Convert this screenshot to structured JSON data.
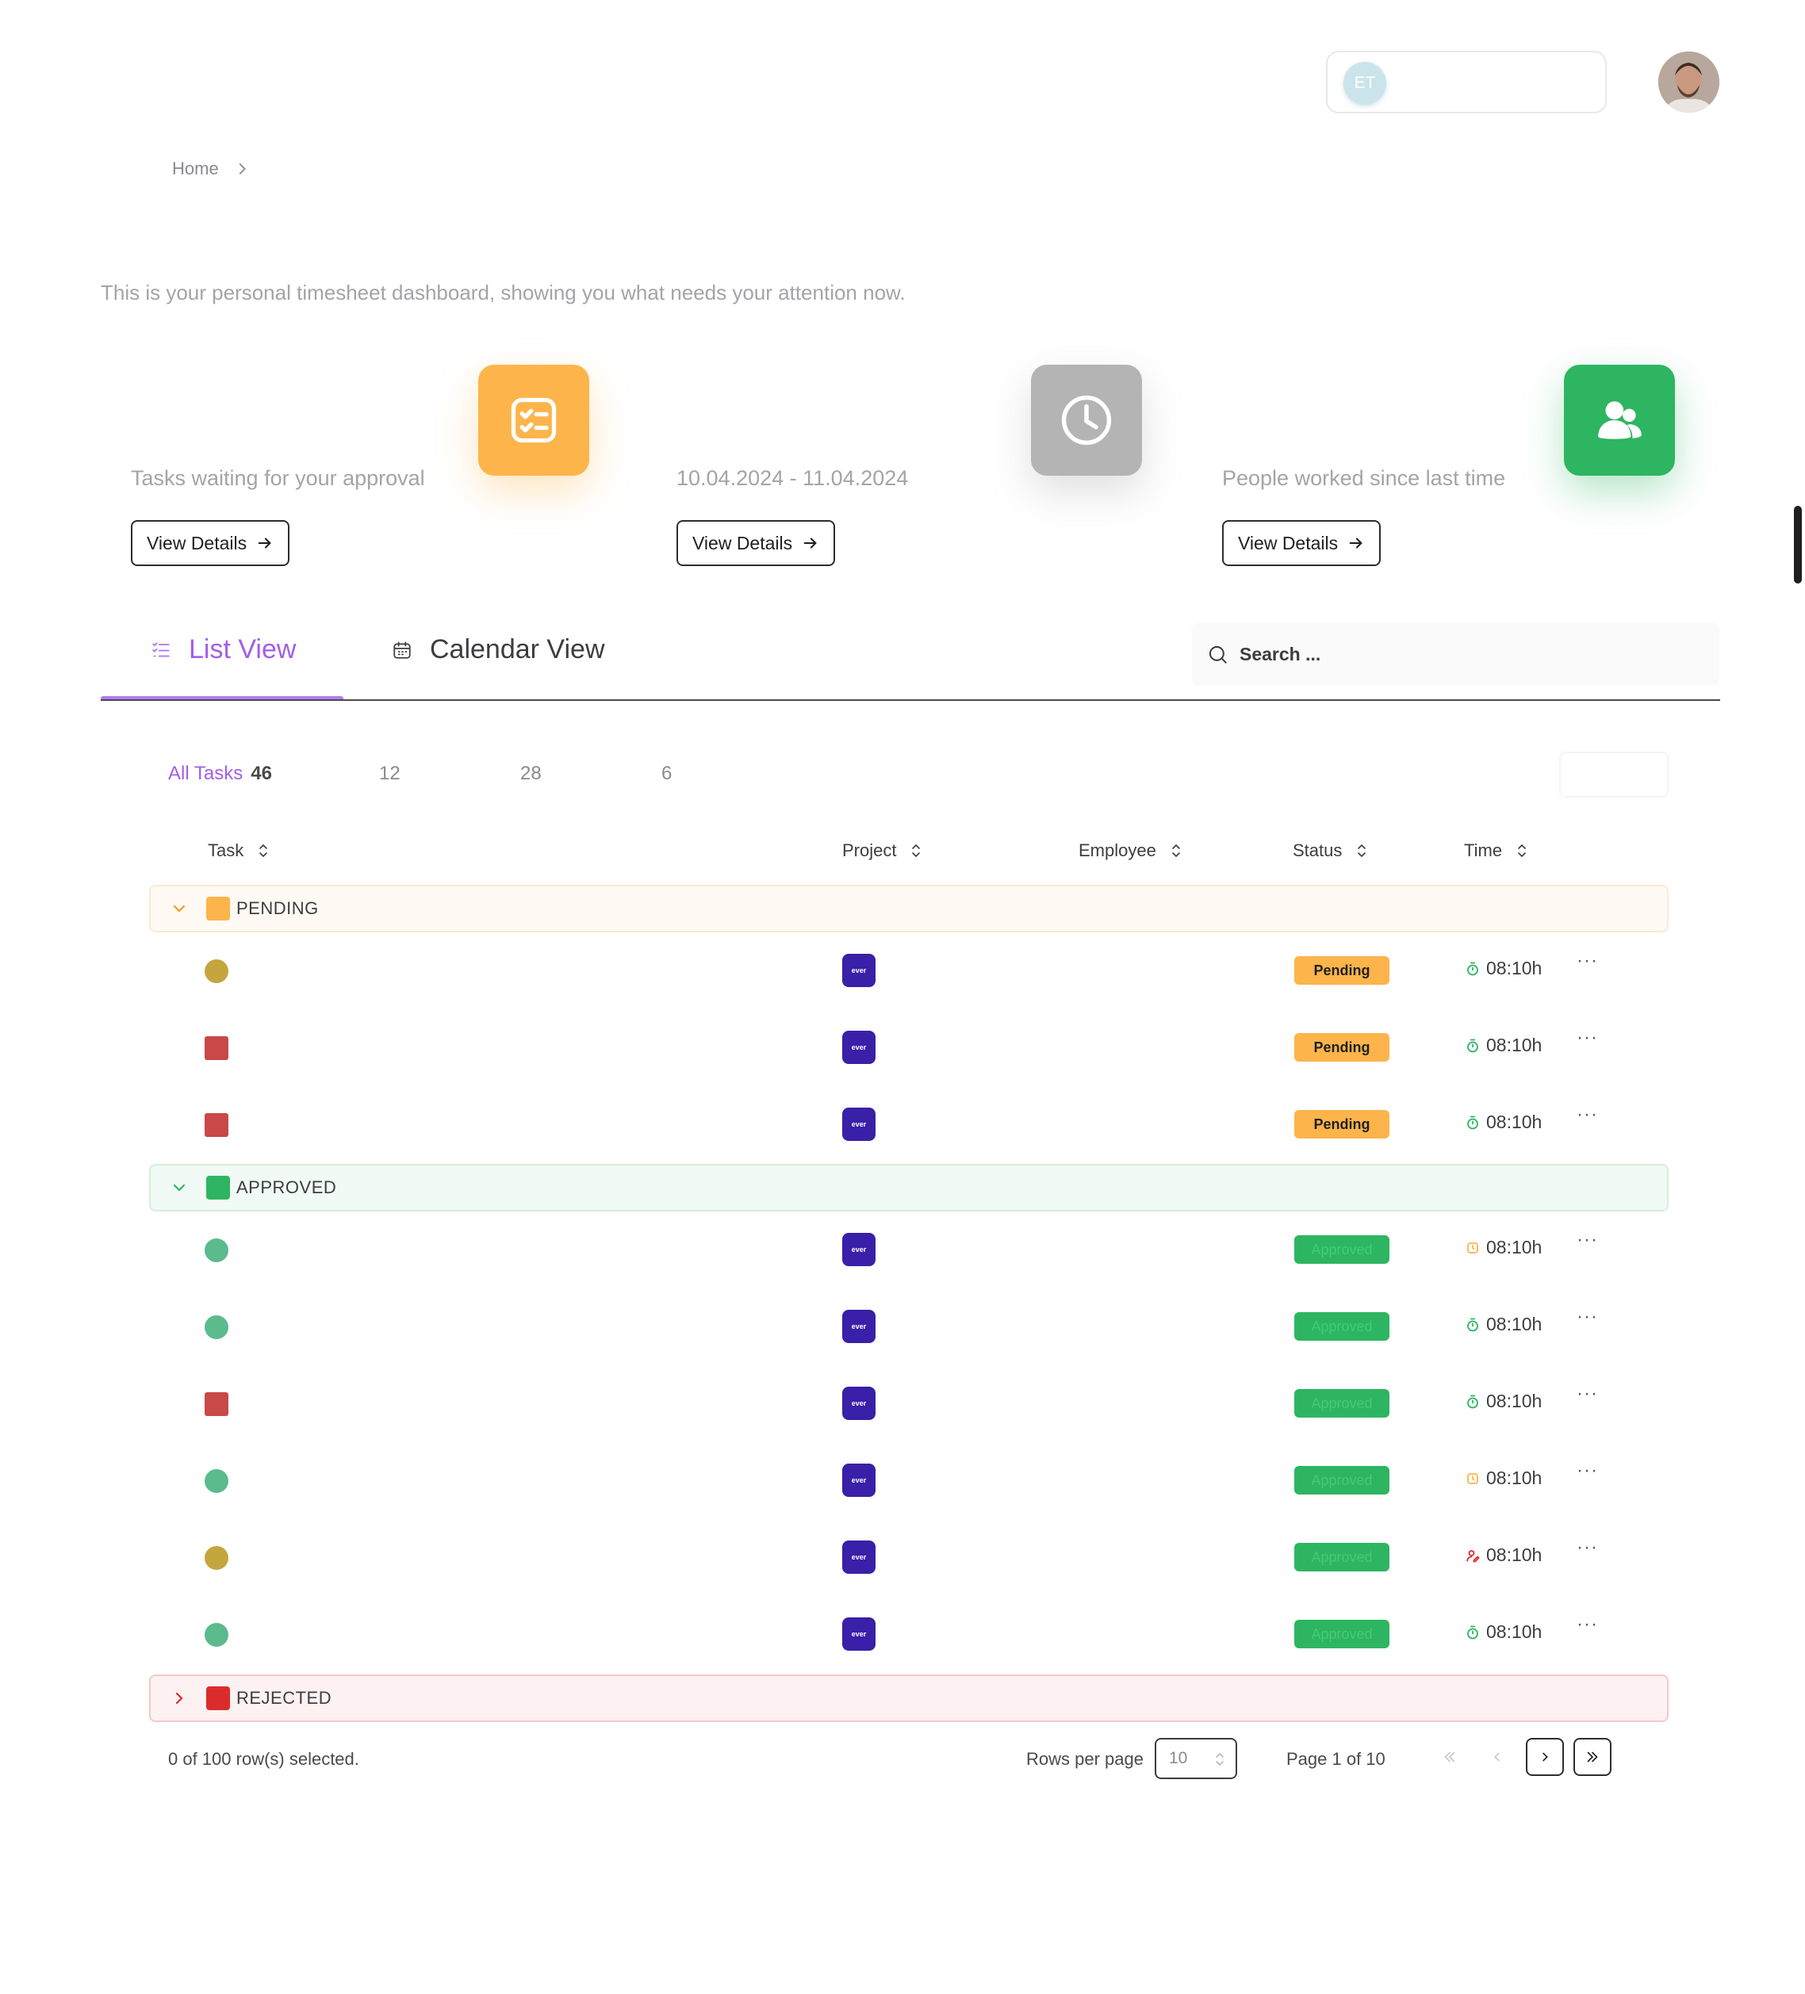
{
  "header": {
    "team_initials": "ET"
  },
  "breadcrumb": {
    "home": "Home"
  },
  "subtitle": "This is your personal timesheet dashboard, showing you what needs your attention now.",
  "stats": [
    {
      "label": "Tasks waiting for your approval",
      "button": "View Details",
      "icon": "task-list-icon",
      "color": "#fdb44b"
    },
    {
      "label": "10.04.2024 - 11.04.2024",
      "button": "View Details",
      "icon": "clock-icon",
      "color": "#b4b4b4"
    },
    {
      "label": "People worked since last time",
      "button": "View Details",
      "icon": "users-icon",
      "color": "#2eb561"
    }
  ],
  "tabs": {
    "list": "List View",
    "calendar": "Calendar View",
    "active": "list"
  },
  "search": {
    "placeholder": "Search ..."
  },
  "filters": [
    {
      "label": "All Tasks",
      "count": "46",
      "active": true
    },
    {
      "label": "",
      "count": "12"
    },
    {
      "label": "",
      "count": "28"
    },
    {
      "label": "",
      "count": "6"
    }
  ],
  "table": {
    "columns": [
      "Task",
      "Project",
      "Employee",
      "Status",
      "Time"
    ],
    "groups": [
      {
        "name": "PENDING",
        "color": "#fdb44b",
        "expanded": true,
        "rows": [
          {
            "marker": "circle",
            "marker_color": "#c5a53e",
            "project": "ever",
            "status": "Pending",
            "time": "08:10h",
            "time_icon": "timer-icon"
          },
          {
            "marker": "square",
            "marker_color": "#c94848",
            "project": "ever",
            "status": "Pending",
            "time": "08:10h",
            "time_icon": "timer-icon"
          },
          {
            "marker": "square",
            "marker_color": "#c94848",
            "project": "ever",
            "status": "Pending",
            "time": "08:10h",
            "time_icon": "timer-icon"
          }
        ]
      },
      {
        "name": "APPROVED",
        "color": "#2eb561",
        "expanded": true,
        "rows": [
          {
            "marker": "circle",
            "marker_color": "#5bbb8c",
            "project": "ever",
            "status": "Approved",
            "time": "08:10h",
            "time_icon": "manual-time-icon"
          },
          {
            "marker": "circle",
            "marker_color": "#5bbb8c",
            "project": "ever",
            "status": "Approved",
            "time": "08:10h",
            "time_icon": "timer-icon"
          },
          {
            "marker": "square",
            "marker_color": "#c94848",
            "project": "ever",
            "status": "Approved",
            "time": "08:10h",
            "time_icon": "timer-icon"
          },
          {
            "marker": "circle",
            "marker_color": "#5bbb8c",
            "project": "ever",
            "status": "Approved",
            "time": "08:10h",
            "time_icon": "manual-time-icon"
          },
          {
            "marker": "circle",
            "marker_color": "#c5a53e",
            "project": "ever",
            "status": "Approved",
            "time": "08:10h",
            "time_icon": "user-edit-icon"
          },
          {
            "marker": "circle",
            "marker_color": "#5bbb8c",
            "project": "ever",
            "status": "Approved",
            "time": "08:10h",
            "time_icon": "timer-icon"
          }
        ]
      },
      {
        "name": "REJECTED",
        "color": "#dc2b2b",
        "expanded": false,
        "rows": []
      }
    ]
  },
  "footer": {
    "selected": "0 of 100 row(s) selected.",
    "rows_per_page_label": "Rows per page",
    "rows_per_page_value": "10",
    "page_info": "Page 1 of 10"
  },
  "colors": {
    "accent": "#a35ee8",
    "pending": "#fdb44b",
    "approved": "#2eb561",
    "rejected": "#dc2b2b",
    "project_logo": "#3a1fa8"
  }
}
